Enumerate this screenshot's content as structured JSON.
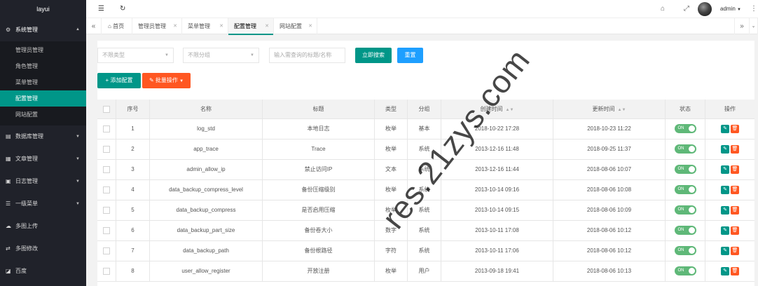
{
  "sidebar": {
    "logo": "layui",
    "menus": [
      {
        "label": "系统管理",
        "icon": "gear-icon",
        "open": true,
        "children": [
          "管理员管理",
          "角色管理",
          "菜单管理",
          "配置管理",
          "网站配置"
        ],
        "active_index": 3
      },
      {
        "label": "数据库管理",
        "icon": "database-icon"
      },
      {
        "label": "文章管理",
        "icon": "article-icon"
      },
      {
        "label": "日志管理",
        "icon": "log-icon"
      },
      {
        "label": "一级菜单",
        "icon": "menu-icon"
      },
      {
        "label": "多图上传",
        "icon": "upload-icon"
      },
      {
        "label": "多图修改",
        "icon": "edit-images-icon"
      },
      {
        "label": "百度",
        "icon": "baidu-icon"
      }
    ]
  },
  "topbar": {
    "user": "admin"
  },
  "tabs": [
    {
      "label": "首页",
      "closable": false
    },
    {
      "label": "管理员管理",
      "closable": true
    },
    {
      "label": "菜单管理",
      "closable": true
    },
    {
      "label": "配置管理",
      "closable": true,
      "active": true
    },
    {
      "label": "网站配置",
      "closable": true
    }
  ],
  "filters": {
    "type_placeholder": "不限类型",
    "group_placeholder": "不限分组",
    "search_placeholder": "输入需查询的标题/名称",
    "search_button": "立即搜索",
    "reset_button": "重置",
    "add_button": "添加配置",
    "batch_button": "批量操作"
  },
  "table": {
    "headers": [
      "序号",
      "名称",
      "标题",
      "类型",
      "分组",
      "创建时间",
      "更新时间",
      "状态",
      "操作"
    ],
    "rows": [
      {
        "no": "1",
        "name": "log_std",
        "title": "本地日志",
        "type": "枚举",
        "group": "基本",
        "created": "2018-10-22 17:28",
        "updated": "2018-10-23 11:22",
        "status": "ON"
      },
      {
        "no": "2",
        "name": "app_trace",
        "title": "Trace",
        "type": "枚举",
        "group": "系统",
        "created": "2013-12-16 11:48",
        "updated": "2018-09-25 11:37",
        "status": "ON"
      },
      {
        "no": "3",
        "name": "admin_allow_ip",
        "title": "禁止访问IP",
        "type": "文本",
        "group": "系统",
        "created": "2013-12-16 11:44",
        "updated": "2018-08-06 10:07",
        "status": "ON"
      },
      {
        "no": "4",
        "name": "data_backup_compress_level",
        "title": "备份压缩级别",
        "type": "枚举",
        "group": "系统",
        "created": "2013-10-14 09:16",
        "updated": "2018-08-06 10:08",
        "status": "ON"
      },
      {
        "no": "5",
        "name": "data_backup_compress",
        "title": "是否启用压缩",
        "type": "枚举",
        "group": "系统",
        "created": "2013-10-14 09:15",
        "updated": "2018-08-06 10:09",
        "status": "ON"
      },
      {
        "no": "6",
        "name": "data_backup_part_size",
        "title": "备份卷大小",
        "type": "数字",
        "group": "系统",
        "created": "2013-10-11 17:08",
        "updated": "2018-08-06 10:12",
        "status": "ON"
      },
      {
        "no": "7",
        "name": "data_backup_path",
        "title": "备份根路径",
        "type": "字符",
        "group": "系统",
        "created": "2013-10-11 17:06",
        "updated": "2018-08-06 10:12",
        "status": "ON"
      },
      {
        "no": "8",
        "name": "user_allow_register",
        "title": "开放注册",
        "type": "枚举",
        "group": "用户",
        "created": "2013-09-18 19:41",
        "updated": "2018-08-06 10:13",
        "status": "ON"
      }
    ]
  },
  "watermark": "res.21zys.com"
}
